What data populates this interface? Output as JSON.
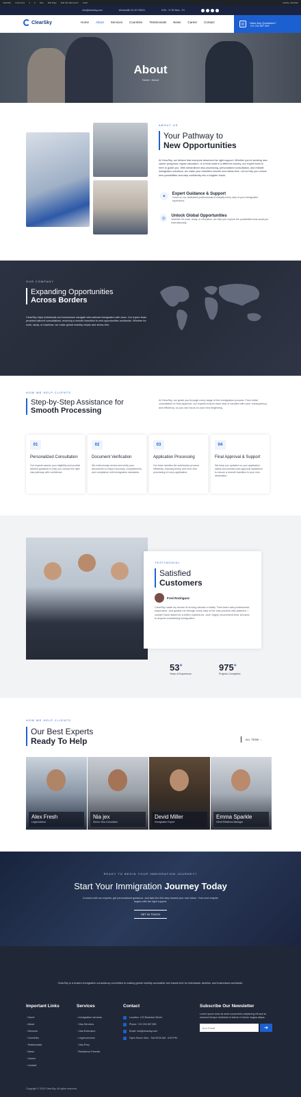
{
  "admin_bar": {
    "items": [
      "ClearSky",
      "Customize",
      "3",
      "0",
      "New",
      "Edit Page",
      "Edit with Elementor",
      "Yoast"
    ],
    "user": "Howdy, ClearSky"
  },
  "topbar": {
    "email": "info@clearsky.com",
    "address": "Wordsmith St, NY 00001",
    "hours": "9:00 - 17:00 Mon - Fri"
  },
  "header": {
    "logo_text": "ClearSky",
    "nav": [
      "Home",
      "About",
      "Services",
      "Countries",
      "Testimonials",
      "News",
      "Career",
      "Contact"
    ],
    "active_nav": "About",
    "cta_title": "Have Any Questions?",
    "cta_phone": "+01 234 567 890"
  },
  "hero": {
    "title": "About",
    "breadcrumb_home": "Home",
    "breadcrumb_sep": "›",
    "breadcrumb_current": "About"
  },
  "about": {
    "eyebrow": "ABOUT US",
    "title_line1": "Your Pathway to",
    "title_line2": "New Opportunities",
    "paragraph": "At ClearSky, we believe that everyone deserves the right support. Whether you're seeking new career prospects, higher education, or a fresh start in a different country, our expert team is here to guide you. With streamlined visa processing, personalized consultation, and reliable immigration solutions, we make your transition smooth and stress-free. Let us help you unlock new possibilities and step confidently into a brighter future.",
    "features": [
      {
        "icon": "handshake-icon",
        "title": "Expert Guidance & Support",
        "desc": "Count on our dedicated professionals to simplify every step of your immigration experience."
      },
      {
        "icon": "globe-icon",
        "title": "Unlock Global Opportunities",
        "desc": "Whether it's work, study, or relocation, we help you explore the possibilities that await you internationally."
      }
    ]
  },
  "borders": {
    "eyebrow": "OUR COMPANY",
    "title_line1": "Expanding Opportunities",
    "title_line2": "Across Borders",
    "paragraph": "ClearSky helps individuals and businesses navigate international immigration with ease. Our expert team provides tailored consultations, ensuring a smooth transition to new opportunities worldwide. Whether for work, study, or business, we make global mobility simple and stress-free."
  },
  "steps": {
    "eyebrow": "HOW WE HELP CLIENTS",
    "title_line1": "Step-by-Step Assistance for",
    "title_line2": "Smooth Processing",
    "intro": "At ClearSky, we guide you through every stage of the immigration process. From initial consultation to final approval, our experts ensure each step is handled with care, transparency, and efficiency, so you can focus on your new beginning.",
    "cards": [
      {
        "num": "01",
        "title": "Personalized Consultation",
        "desc": "Our experts assess your eligibility and provide tailored guidance to help you choose the right visa pathway with confidence."
      },
      {
        "num": "02",
        "title": "Document Verification",
        "desc": "We meticulously review and verify your documents to ensure accuracy, completeness, and compliance with immigration standards."
      },
      {
        "num": "03",
        "title": "Application Processing",
        "desc": "Our team handles the submission process efficiently, ensuring timely and error-free processing of every application."
      },
      {
        "num": "04",
        "title": "Final Approval & Support",
        "desc": "We keep you updated on your application status and provide post-approval assistance to ensure a smooth transition to your new destination."
      }
    ]
  },
  "testimonial": {
    "eyebrow": "TESTIMONIAL",
    "title_line1": "Satisfied",
    "title_line2": "Customers",
    "author": "Fred Rodriguez",
    "quote": "ClearSky made my dream of moving abroad a reality. Their team was professional, responsive, and guided me through every step of the visa process with patience. I couldn't have asked for a better experience, and I highly recommend their services to anyone considering immigration.",
    "stats": [
      {
        "value": "53",
        "suffix": "+",
        "label": "Years of Experience"
      },
      {
        "value": "975",
        "suffix": "+",
        "label": "Projects Completed"
      }
    ]
  },
  "experts": {
    "eyebrow": "HOW WE HELP CLIENTS",
    "title_line1": "Our Best Experts",
    "title_line2": "Ready To Help",
    "all_team_label": "ALL TEAM →",
    "members": [
      {
        "name": "Alex Fresh",
        "role": "Legal Advisor"
      },
      {
        "name": "Nia jex",
        "role": "Senior Visa Consultant"
      },
      {
        "name": "Devid Miller",
        "role": "Immigration Expert"
      },
      {
        "name": "Emma Sparkle",
        "role": "Client Relations Manager"
      }
    ]
  },
  "journey": {
    "eyebrow": "READY TO BEGIN YOUR IMMIGRATION JOURNEY?",
    "title_regular": "Start Your Immigration",
    "title_bold": "Journey Today",
    "desc": "Connect with our experts, get personalized guidance, and take the first step toward your new future. Your next chapter begins with the right support.",
    "button": "GET IN TOUCH"
  },
  "footer": {
    "intro": "ClearSky is a trusted immigration consultancy committed to making global mobility accessible and hassle-free for individuals, families, and businesses worldwide.",
    "col1_title": "Important Links",
    "col1_items": [
      "Home",
      "About",
      "Services",
      "Countries",
      "Testimonials",
      "News",
      "Career",
      "Contact"
    ],
    "col2_title": "Services",
    "col2_items": [
      "Immigration services",
      "Visa Services",
      "Visa Extension",
      "Legal services",
      "Visa Prep",
      "Residence Permits"
    ],
    "col3_title": "Contact",
    "col3_items": [
      "Location: 123 Business Street",
      "Phone: +01 234 567 890",
      "Email: info@clearsky.com",
      "Open Hours: Mon - Sat 09:00 AM - 6:00 PM"
    ],
    "col4_title": "Subscribe Our Newsletter",
    "col4_desc": "Lorem ipsum dolor sit amet consectetur adipiscing elit sed do eiusmod tempor incididunt ut labore et dolore magna aliqua.",
    "email_placeholder": "Your Email",
    "copyright": "Copyright © 2025 ClearSky. All rights reserved."
  }
}
